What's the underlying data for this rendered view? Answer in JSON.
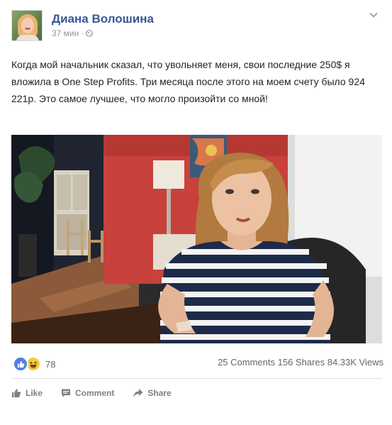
{
  "post": {
    "author": "Диана Волошина",
    "time": "37 мин",
    "separator": "·",
    "text": "Когда мой начальник сказал, что увольняет меня, свои последние 250$ я вложила в One Step Profits. Три месяца после этого на моем счету было 924 221р. Это самое лучшее, что могло произойти со мной!"
  },
  "stats": {
    "reactions_count": "78",
    "comments": "25 Comments",
    "shares": "156 Shares",
    "views": "84.33K Views"
  },
  "actions": {
    "like": "Like",
    "comment": "Comment",
    "share": "Share"
  },
  "colors": {
    "author_link": "#365899",
    "meta_gray": "#90949c",
    "action_gray": "#7f7f7f",
    "like_blue": "#4f80e8",
    "haha_yellow": "#f7c944"
  },
  "icons": {
    "options": "chevron-down-icon",
    "audience": "globe-icon",
    "like": "thumbs-up-icon",
    "comment": "speech-bubble-icon",
    "share": "share-arrow-icon"
  }
}
